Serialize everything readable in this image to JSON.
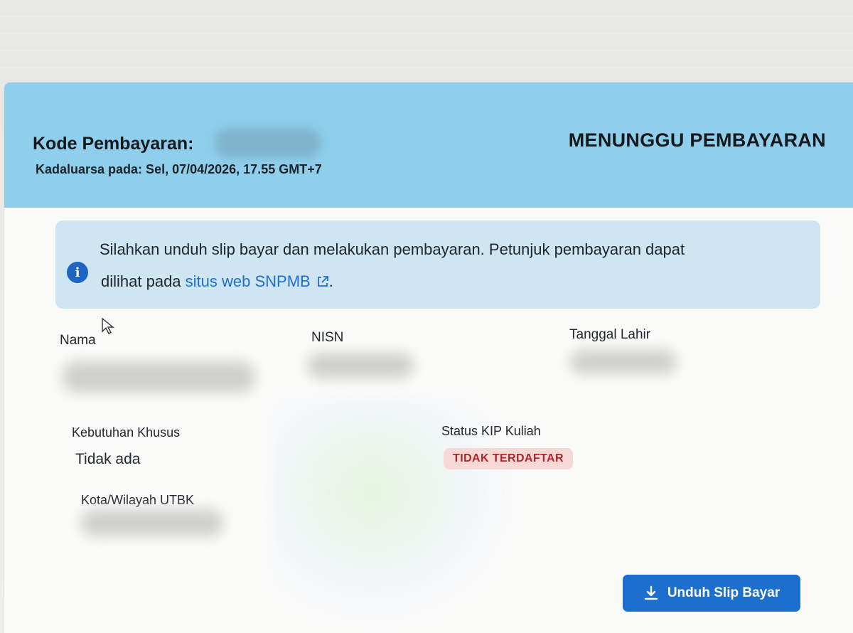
{
  "payment": {
    "code_label": "Kode Pembayaran:",
    "expiry": "Kadaluarsa pada: Sel, 07/04/2026, 17.55 GMT+7",
    "status": "MENUNGGU PEMBAYARAN"
  },
  "notice": {
    "icon": "info-icon",
    "line1": "Silahkan unduh slip bayar dan melakukan pembayaran. Petunjuk pembayaran dapat",
    "line2_prefix": "dilihat pada ",
    "link_text": "situs web SNPMB",
    "link_icon": "external-link-icon",
    "line2_suffix": "."
  },
  "fields": {
    "nama_label": "Nama",
    "nisn_label": "NISN",
    "tanggal_lahir_label": "Tanggal Lahir",
    "kebutuhan_khusus_label": "Kebutuhan Khusus",
    "kebutuhan_khusus_value": "Tidak ada",
    "status_kip_label": "Status KIP Kuliah",
    "status_kip_value": "TIDAK TERDAFTAR",
    "kota_label": "Kota/Wilayah UTBK"
  },
  "download": {
    "label": "Unduh Slip Bayar",
    "icon": "download-icon"
  },
  "colors": {
    "header_bg": "#8fcfec",
    "notice_bg": "#cfe6f2",
    "link": "#1f6fd1",
    "badge_bg": "#f6d9d7",
    "badge_text": "#b02727",
    "button_bg": "#1d6fce"
  }
}
